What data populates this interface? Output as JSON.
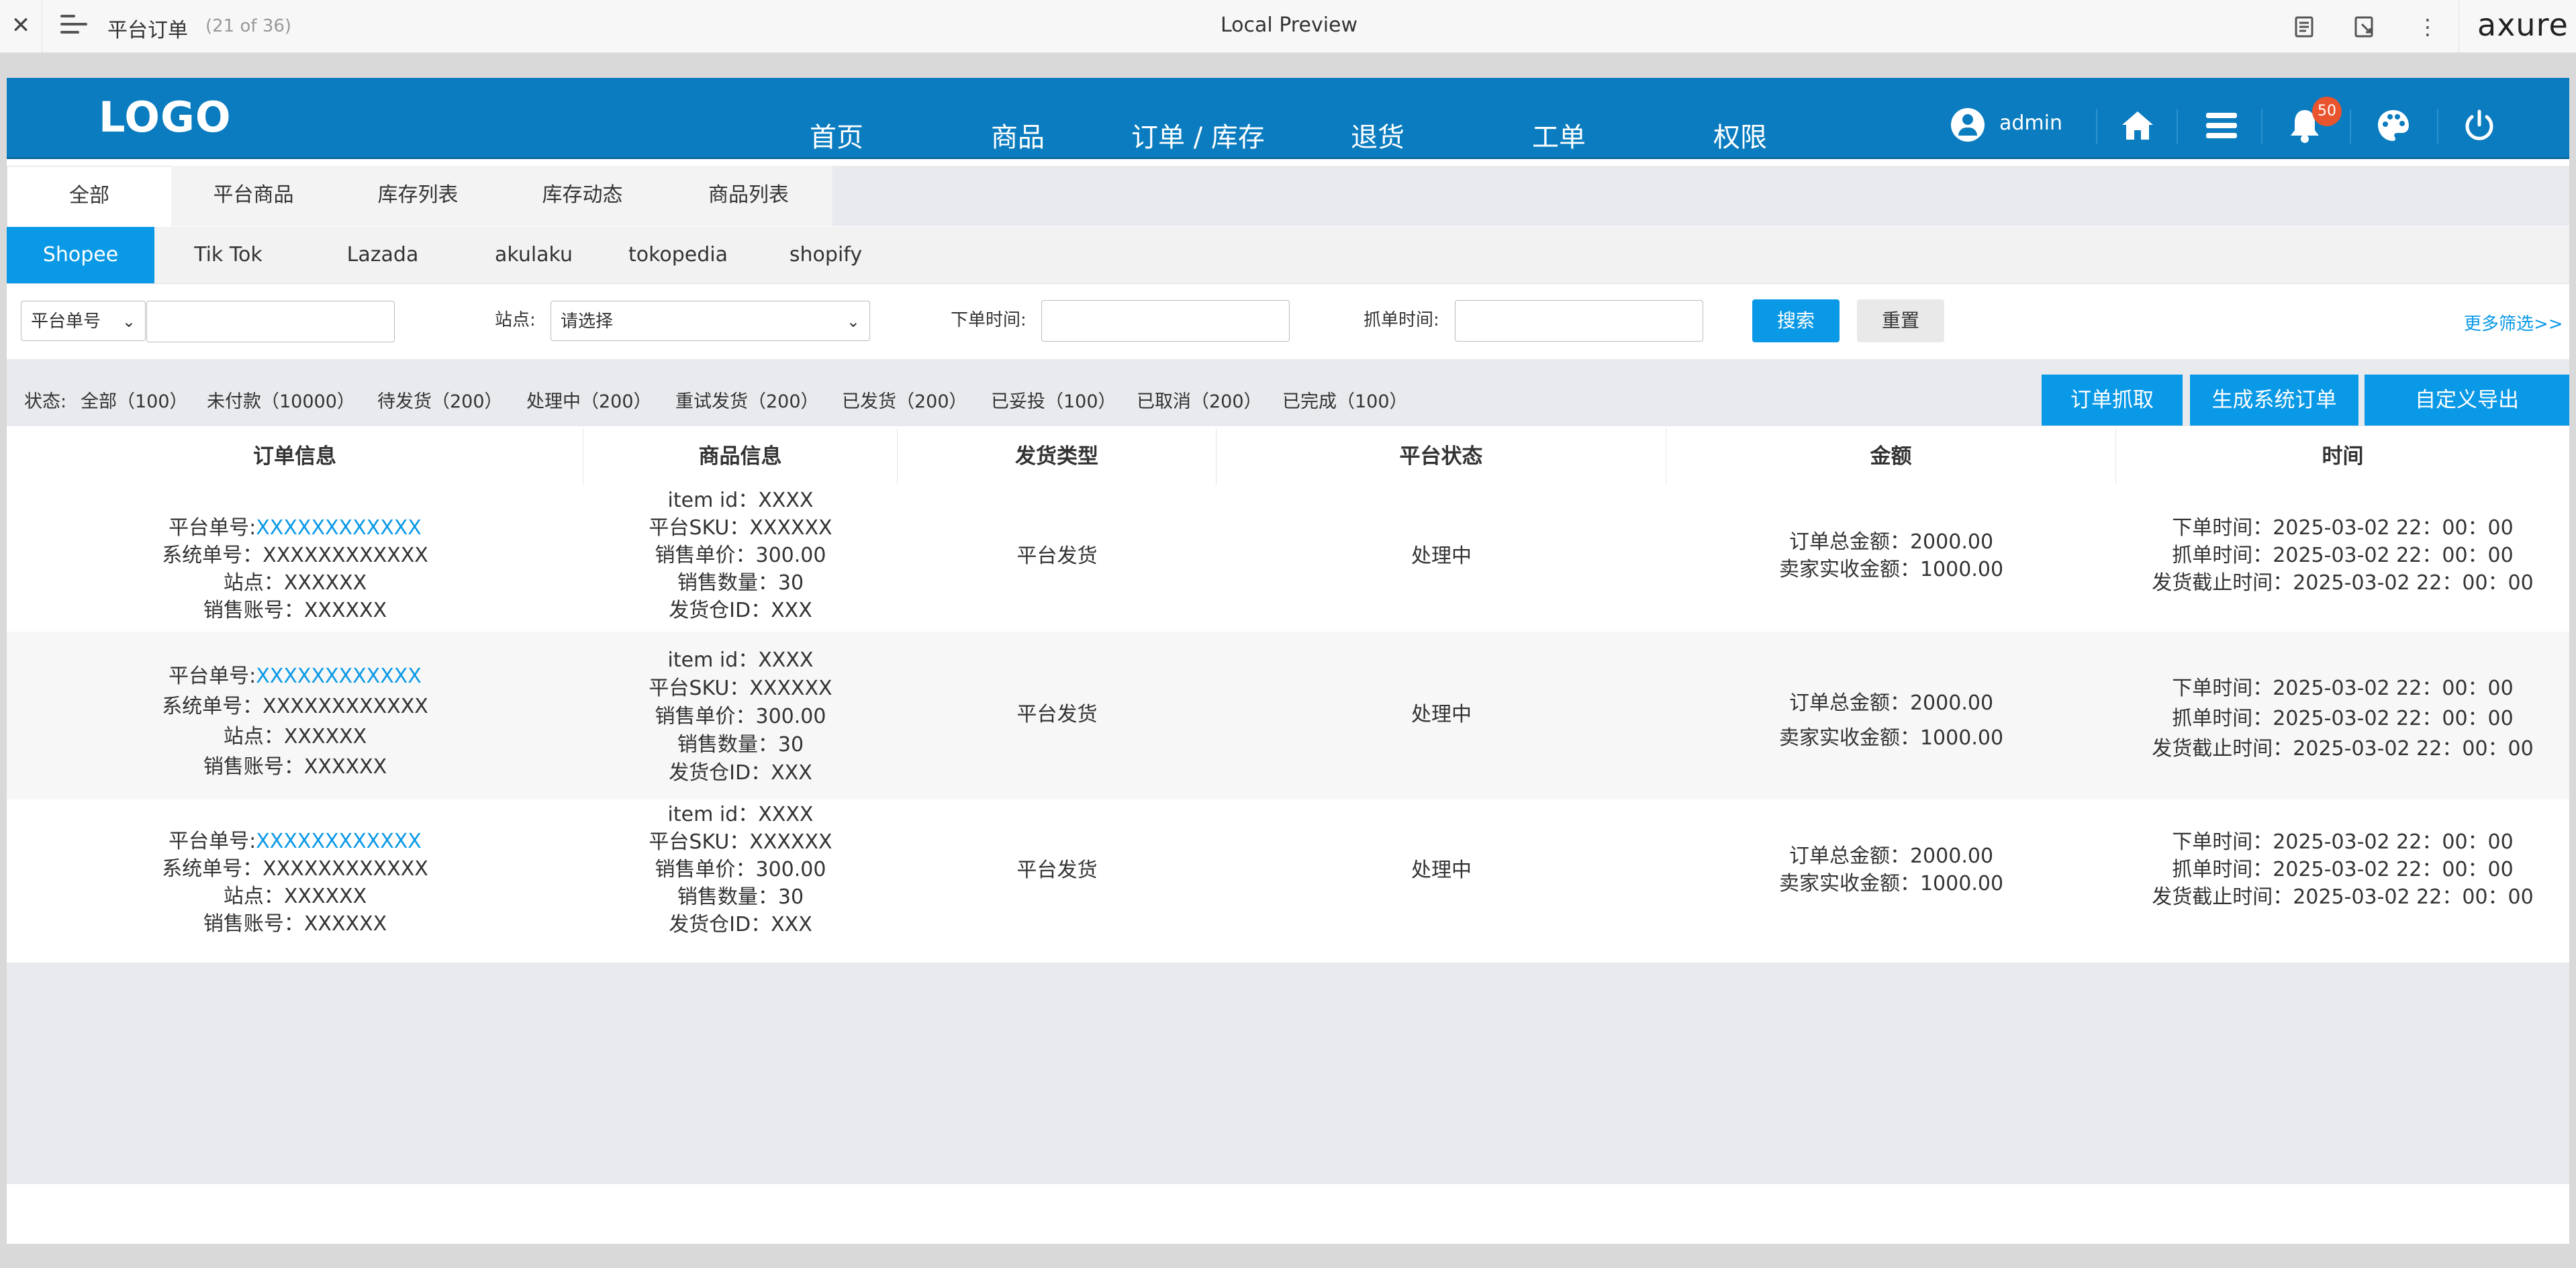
{
  "chrome": {
    "page_name": "平台订单",
    "page_count": "(21 of 36)",
    "preview_label": "Local Preview",
    "brand": "axure"
  },
  "header": {
    "logo": "LOGO",
    "nav": [
      "首页",
      "商品",
      "订单 / 库存",
      "退货",
      "工单",
      "权限"
    ],
    "user": "admin",
    "notification_count": "50"
  },
  "tabs_primary": [
    "全部",
    "平台商品",
    "库存列表",
    "库存动态",
    "商品列表"
  ],
  "tabs_platform": [
    "Shopee",
    "Tik Tok",
    "Lazada",
    "akulaku",
    "tokopedia",
    "shopify"
  ],
  "filter": {
    "type_select": "平台单号",
    "site_label": "站点:",
    "site_select": "请选择",
    "order_time_label": "下单时间:",
    "grab_time_label": "抓单时间:",
    "search": "搜索",
    "reset": "重置",
    "more": "更多筛选>>"
  },
  "status": {
    "prefix": "状态:",
    "items": [
      "全部（100）",
      "未付款（10000）",
      "待发货（200）",
      "处理中（200）",
      "重试发货（200）",
      "已发货（200）",
      "已妥投（100）",
      "已取消（200）",
      "已完成（100）"
    ]
  },
  "actions": [
    "订单抓取",
    "生成系统订单",
    "自定义导出"
  ],
  "table": {
    "headers": [
      "订单信息",
      "商品信息",
      "发货类型",
      "平台状态",
      "金额",
      "时间"
    ],
    "rows": [
      {
        "order": {
          "platform_label": "平台单号:",
          "platform_no": "XXXXXXXXXXXX",
          "system": "系统单号：XXXXXXXXXXXX",
          "site": "站点：XXXXXX",
          "account": "销售账号：XXXXXX"
        },
        "product": [
          "item id：XXXX",
          "平台SKU：XXXXXX",
          "销售单价：300.00",
          "销售数量：30",
          "发货仓ID：XXX"
        ],
        "ship_type": "平台发货",
        "status": "处理中",
        "amount": [
          "订单总金额：2000.00",
          "卖家实收金额：1000.00"
        ],
        "time": [
          "下单时间：2025-03-02 22：00：00",
          "抓单时间：2025-03-02 22：00：00",
          "发货截止时间：2025-03-02 22：00：00"
        ]
      },
      {
        "order": {
          "platform_label": "平台单号:",
          "platform_no": "XXXXXXXXXXXX",
          "system": "系统单号：XXXXXXXXXXXX",
          "site": "站点：XXXXXX",
          "account": "销售账号：XXXXXX"
        },
        "product": [
          "item id：XXXX",
          "平台SKU：XXXXXX",
          "销售单价：300.00",
          "销售数量：30",
          "发货仓ID：XXX"
        ],
        "ship_type": "平台发货",
        "status": "处理中",
        "amount": [
          "订单总金额：2000.00",
          "卖家实收金额：1000.00"
        ],
        "time": [
          "下单时间：2025-03-02 22：00：00",
          "抓单时间：2025-03-02 22：00：00",
          "发货截止时间：2025-03-02 22：00：00"
        ]
      },
      {
        "order": {
          "platform_label": "平台单号:",
          "platform_no": "XXXXXXXXXXXX",
          "system": "系统单号：XXXXXXXXXXXX",
          "site": "站点：XXXXXX",
          "account": "销售账号：XXXXXX"
        },
        "product": [
          "item id：XXXX",
          "平台SKU：XXXXXX",
          "销售单价：300.00",
          "销售数量：30",
          "发货仓ID：XXX"
        ],
        "ship_type": "平台发货",
        "status": "处理中",
        "amount": [
          "订单总金额：2000.00",
          "卖家实收金额：1000.00"
        ],
        "time": [
          "下单时间：2025-03-02 22：00：00",
          "抓单时间：2025-03-02 22：00：00",
          "发货截止时间：2025-03-02 22：00：00"
        ]
      }
    ]
  },
  "colors": {
    "header_blue": "#0a7cbf",
    "accent_blue": "#0a99e6",
    "badge_red": "#e8542e"
  }
}
